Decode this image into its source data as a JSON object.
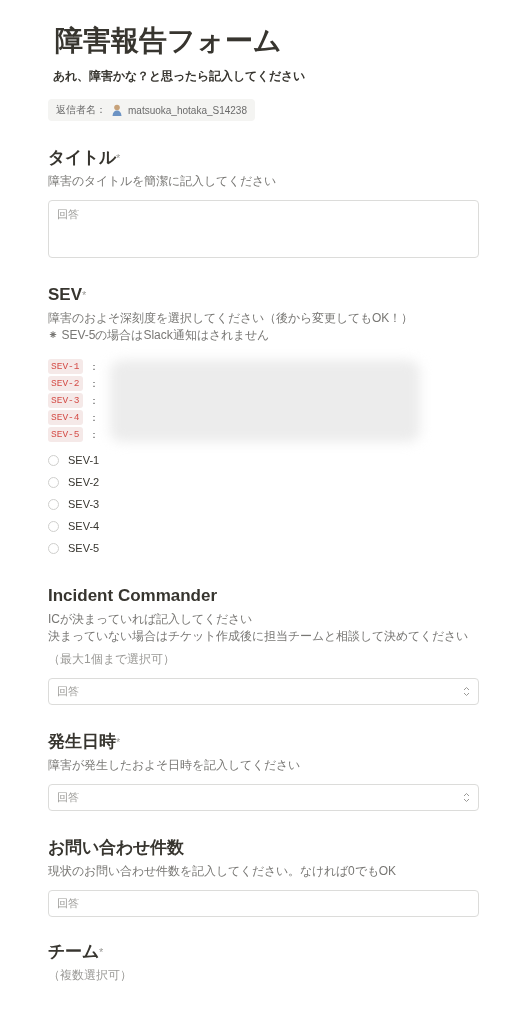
{
  "form": {
    "title": "障害報告フォーム",
    "subtitle": "あれ、障害かな？と思ったら記入してください",
    "respondent": {
      "label": "返信者名：",
      "name": "matsuoka_hotaka_S14238"
    }
  },
  "questions": [
    {
      "title": "タイトル",
      "mark": "*",
      "descriptions": [
        "障害のタイトルを簡潔に記入してください"
      ],
      "field": {
        "kind": "textarea",
        "placeholder": "回答"
      }
    },
    {
      "title": "SEV",
      "mark": "*",
      "descriptions": [
        "障害のおよそ深刻度を選択してください（後から変更してもOK！）",
        "⁕ SEV-5の場合はSlack通知はされません"
      ],
      "legend": [
        {
          "tag": "SEV-1",
          "sep": "："
        },
        {
          "tag": "SEV-2",
          "sep": "："
        },
        {
          "tag": "SEV-3",
          "sep": "："
        },
        {
          "tag": "SEV-4",
          "sep": "："
        },
        {
          "tag": "SEV-5",
          "sep": "："
        }
      ],
      "field": {
        "kind": "radio",
        "options": [
          {
            "label": "SEV-1",
            "selected": false
          },
          {
            "label": "SEV-2",
            "selected": false
          },
          {
            "label": "SEV-3",
            "selected": false
          },
          {
            "label": "SEV-4",
            "selected": false
          },
          {
            "label": "SEV-5",
            "selected": false
          }
        ]
      }
    },
    {
      "title": "Incident Commander",
      "descriptions": [
        "ICが決まっていれば記入してください",
        "決まっていない場合はチケット作成後に担当チームと相談して決めてください"
      ],
      "hint": "（最大1個まで選択可）",
      "field": {
        "kind": "select",
        "placeholder": "回答"
      }
    },
    {
      "title": "発生日時",
      "mark": "*",
      "descriptions": [
        "障害が発生したおよそ日時を記入してください"
      ],
      "field": {
        "kind": "select",
        "placeholder": "回答"
      }
    },
    {
      "title": "お問い合わせ件数",
      "descriptions": [
        "現状のお問い合わせ件数を記入してください。なければ0でもOK"
      ],
      "field": {
        "kind": "input",
        "placeholder": "回答"
      }
    },
    {
      "title": "チーム",
      "mark": "*",
      "hint": "（複数選択可）"
    }
  ]
}
